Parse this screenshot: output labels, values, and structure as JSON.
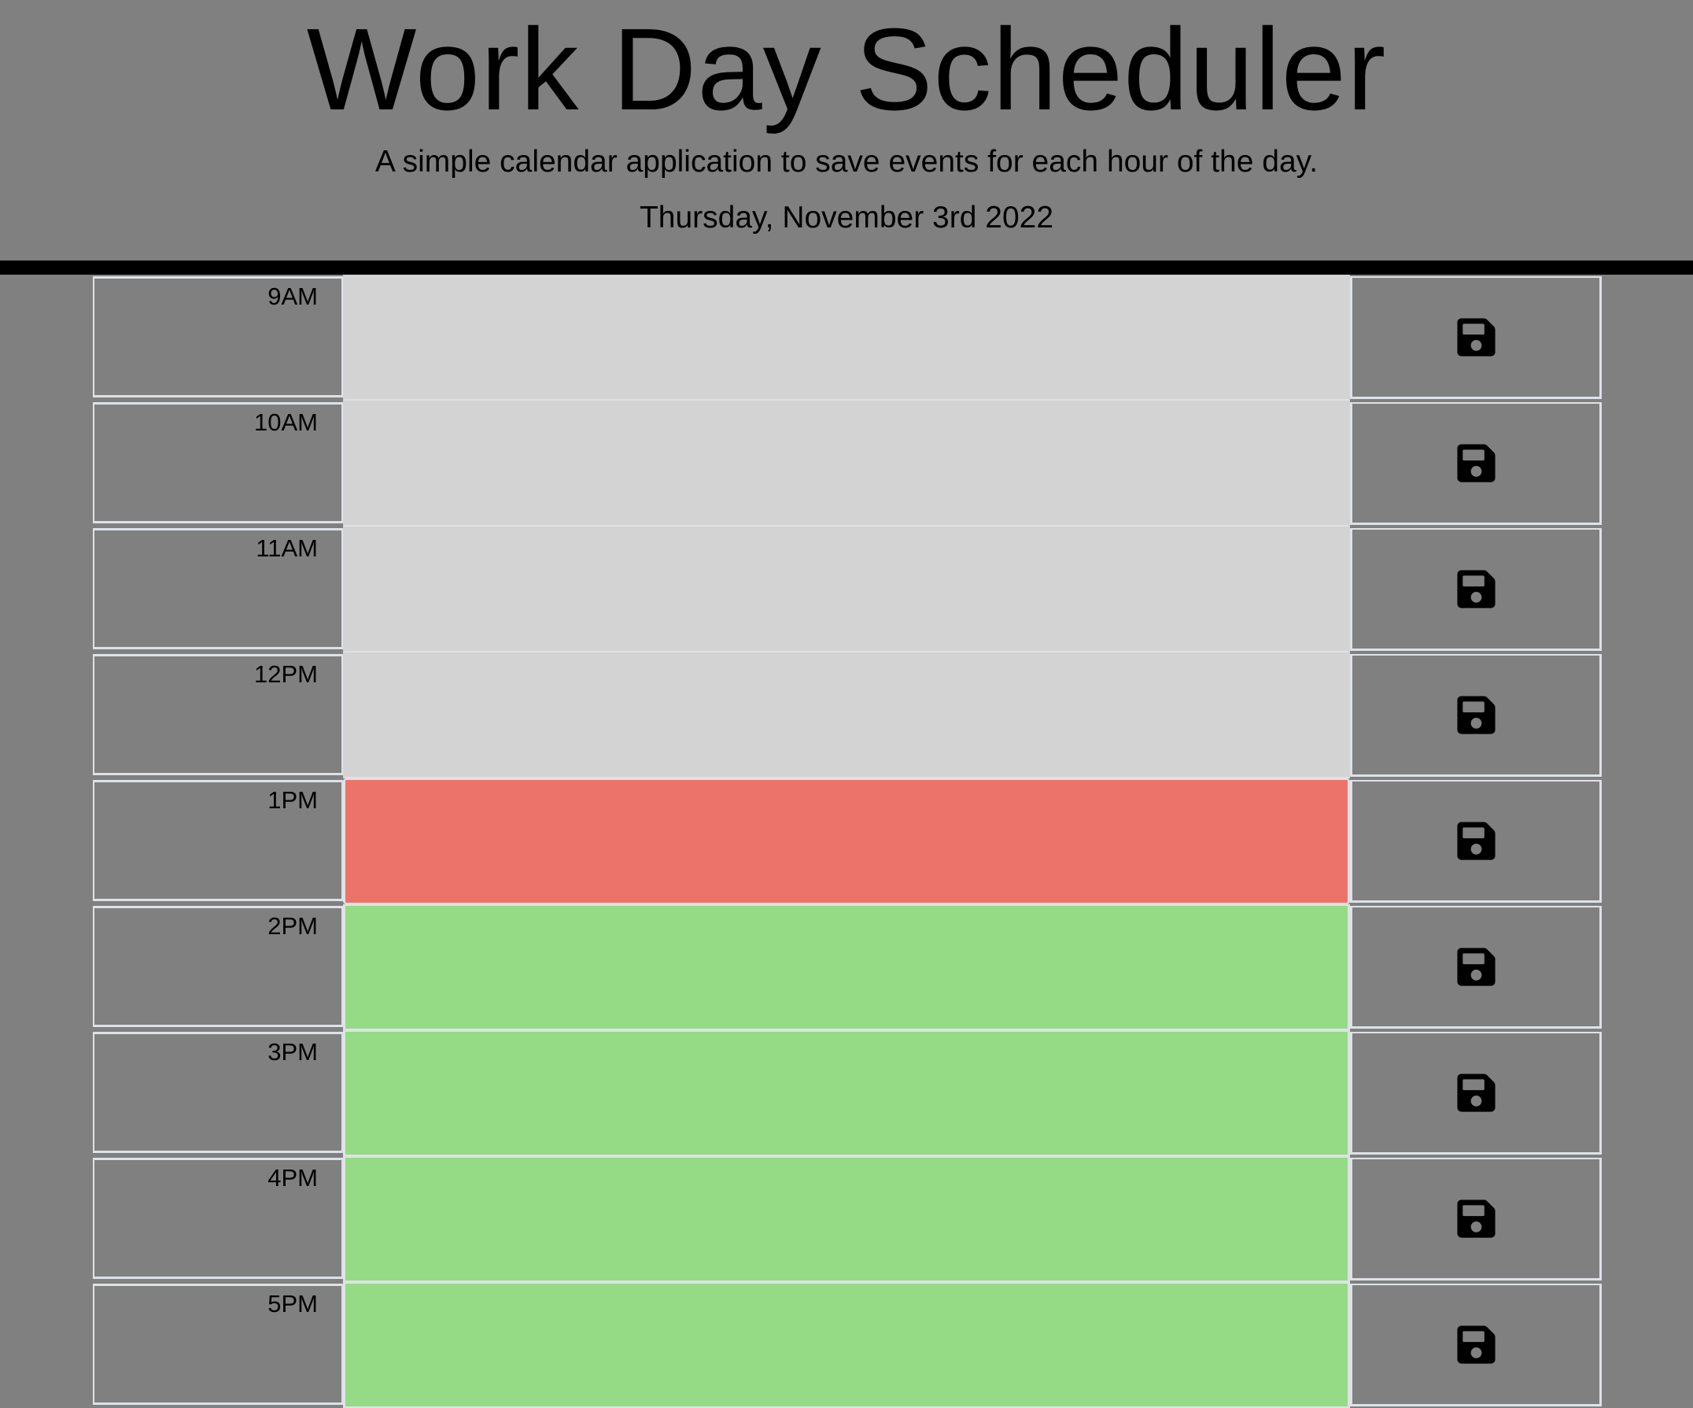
{
  "header": {
    "title": "Work Day Scheduler",
    "subtitle": "A simple calendar application to save events for each hour of the day.",
    "current_day": "Thursday, November 3rd 2022"
  },
  "colors": {
    "background": "#808080",
    "past": "#d3d3d3",
    "present": "#ec7369",
    "future": "#95da84",
    "divider": "#000000"
  },
  "save_icon": "floppy-disk-icon",
  "timeblocks": [
    {
      "hour": "9AM",
      "state": "past",
      "text": ""
    },
    {
      "hour": "10AM",
      "state": "past",
      "text": ""
    },
    {
      "hour": "11AM",
      "state": "past",
      "text": ""
    },
    {
      "hour": "12PM",
      "state": "past",
      "text": ""
    },
    {
      "hour": "1PM",
      "state": "present",
      "text": ""
    },
    {
      "hour": "2PM",
      "state": "future",
      "text": ""
    },
    {
      "hour": "3PM",
      "state": "future",
      "text": ""
    },
    {
      "hour": "4PM",
      "state": "future",
      "text": ""
    },
    {
      "hour": "5PM",
      "state": "future",
      "text": ""
    }
  ]
}
